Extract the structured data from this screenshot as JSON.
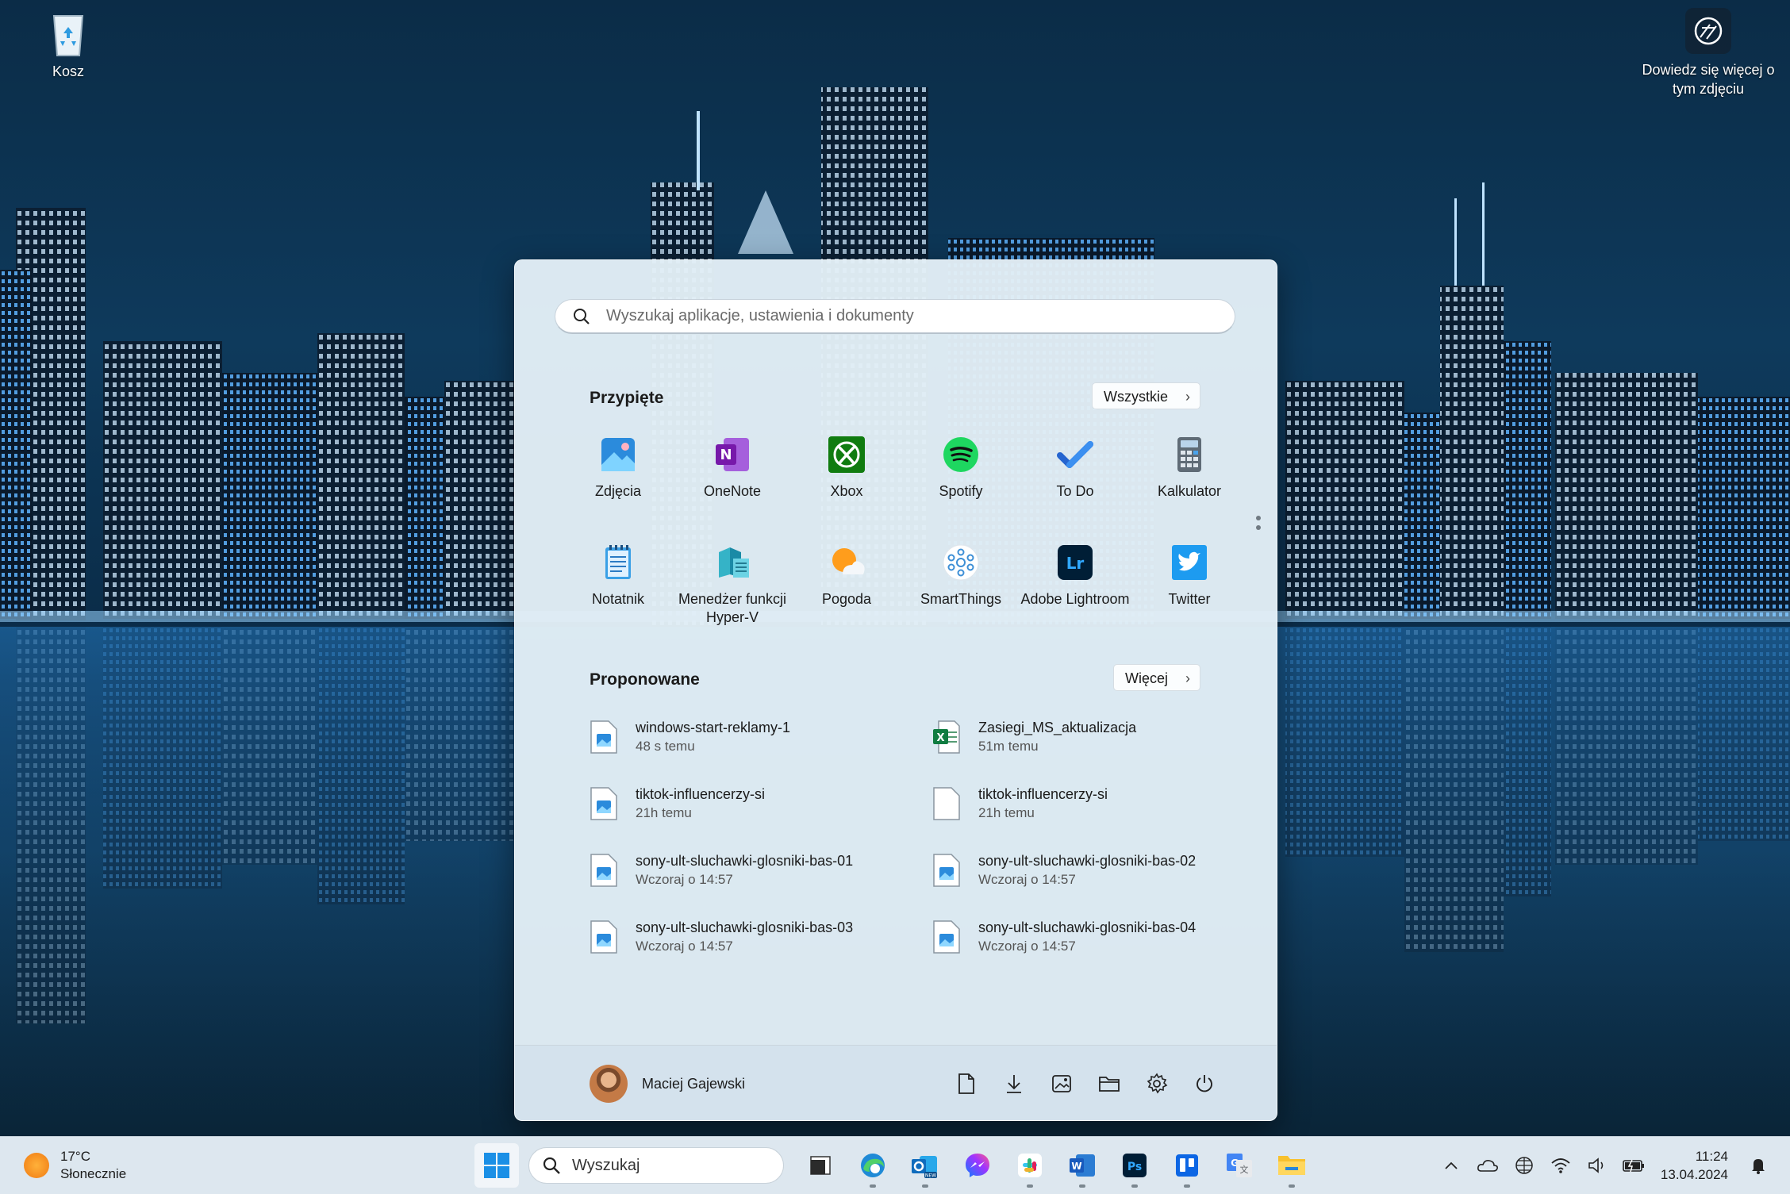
{
  "desktop": {
    "recycle_bin_label": "Kosz",
    "spotlight_label": "Dowiedz się więcej o tym zdjęciu"
  },
  "start_menu": {
    "search_placeholder": "Wyszukaj aplikacje, ustawienia i dokumenty",
    "pinned": {
      "title": "Przypięte",
      "all_button": "Wszystkie",
      "apps": [
        {
          "label": "Zdjęcia",
          "icon": "photos-icon"
        },
        {
          "label": "OneNote",
          "icon": "onenote-icon"
        },
        {
          "label": "Xbox",
          "icon": "xbox-icon"
        },
        {
          "label": "Spotify",
          "icon": "spotify-icon"
        },
        {
          "label": "To Do",
          "icon": "todo-icon"
        },
        {
          "label": "Kalkulator",
          "icon": "calculator-icon"
        },
        {
          "label": "Notatnik",
          "icon": "notepad-icon"
        },
        {
          "label": "Menedżer funkcji Hyper-V",
          "icon": "hyperv-icon"
        },
        {
          "label": "Pogoda",
          "icon": "weather-icon"
        },
        {
          "label": "SmartThings",
          "icon": "smartthings-icon"
        },
        {
          "label": "Adobe Lightroom",
          "icon": "lightroom-icon"
        },
        {
          "label": "Twitter",
          "icon": "twitter-icon"
        }
      ]
    },
    "recommended": {
      "title": "Proponowane",
      "more_button": "Więcej",
      "items": [
        {
          "name": "windows-start-reklamy-1",
          "time": "48 s temu",
          "icon": "image-file-icon"
        },
        {
          "name": "Zasiegi_MS_aktualizacja",
          "time": "51m temu",
          "icon": "excel-file-icon"
        },
        {
          "name": "tiktok-influencerzy-si",
          "time": "21h temu",
          "icon": "image-file-icon"
        },
        {
          "name": "tiktok-influencerzy-si",
          "time": "21h temu",
          "icon": "blank-file-icon"
        },
        {
          "name": "sony-ult-sluchawki-glosniki-bas-01",
          "time": "Wczoraj o 14:57",
          "icon": "image-file-icon"
        },
        {
          "name": "sony-ult-sluchawki-glosniki-bas-02",
          "time": "Wczoraj o 14:57",
          "icon": "image-file-icon"
        },
        {
          "name": "sony-ult-sluchawki-glosniki-bas-03",
          "time": "Wczoraj o 14:57",
          "icon": "image-file-icon"
        },
        {
          "name": "sony-ult-sluchawki-glosniki-bas-04",
          "time": "Wczoraj o 14:57",
          "icon": "image-file-icon"
        }
      ]
    },
    "user_name": "Maciej Gajewski",
    "footer_icons": [
      "documents-icon",
      "downloads-icon",
      "pictures-icon",
      "file-explorer-icon",
      "settings-icon",
      "power-icon"
    ]
  },
  "taskbar": {
    "weather_temp": "17°C",
    "weather_desc": "Słonecznie",
    "search_placeholder": "Wyszukaj",
    "time": "11:24",
    "date": "13.04.2024",
    "apps": [
      "task-view-icon",
      "edge-icon",
      "outlook-new-icon",
      "messenger-icon",
      "slack-icon",
      "word-icon",
      "photoshop-icon",
      "trello-icon",
      "google-translate-icon",
      "file-explorer-icon"
    ],
    "tray_icons": [
      "chevron-up-icon",
      "onedrive-icon",
      "network-globe-icon",
      "wifi-icon",
      "volume-icon",
      "battery-icon",
      "notification-bell-icon"
    ]
  }
}
